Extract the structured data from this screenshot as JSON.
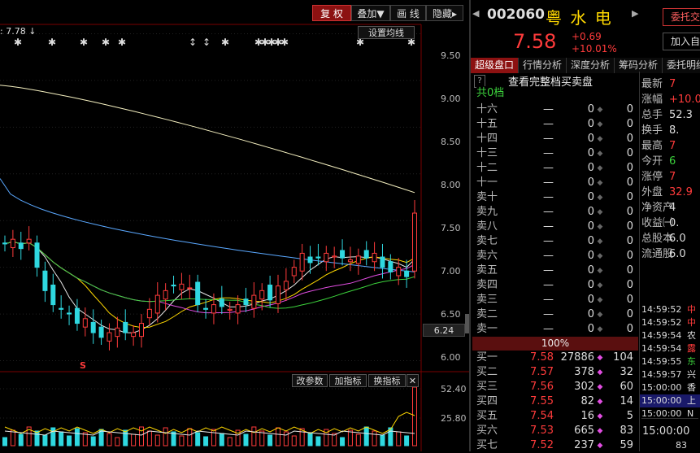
{
  "toolbar": {
    "fuquan": "复 权",
    "diejia": "叠加▼",
    "huaxian": "画 线",
    "yincang": "隐藏▸"
  },
  "chart": {
    "price_marker": ": 7.78 ↓",
    "ma_settings": "设置均线",
    "current_price_tag": "6.24",
    "s_marker": "S",
    "price_axis": [
      "9.50",
      "9.00",
      "8.50",
      "8.00",
      "7.50",
      "7.00",
      "6.50",
      "6.00"
    ],
    "volume_axis": [
      "52.40",
      "25.80"
    ],
    "vol_buttons": {
      "gaicanshu": "改参数",
      "jiazhibiao": "加指标",
      "huanzhibiao": "换指标",
      "close": "✕"
    }
  },
  "chart_data": {
    "type": "candlestick",
    "ylim": [
      5.9,
      9.6
    ],
    "closes": [
      7.25,
      7.3,
      7.2,
      7.3,
      7.0,
      6.75,
      6.6,
      6.55,
      6.5,
      6.4,
      6.45,
      6.3,
      6.25,
      6.3,
      6.35,
      6.3,
      6.3,
      6.4,
      6.55,
      6.7,
      6.75,
      6.8,
      6.82,
      6.78,
      6.6,
      6.55,
      6.6,
      6.58,
      6.55,
      6.6,
      6.6,
      6.7,
      6.75,
      6.65,
      6.8,
      6.85,
      7.0,
      7.15,
      7.05,
      7.1,
      7.15,
      7.12,
      7.1,
      7.08,
      7.12,
      7.1,
      7.15,
      7.0,
      6.95,
      7.0,
      6.9,
      7.58
    ],
    "ma_long_start": 8.95,
    "ma_long_end": 7.8
  },
  "stock": {
    "code": "002060",
    "name": "粤 水 电",
    "price": "7.58",
    "change": "+0.69",
    "change_pct": "+10.01%",
    "btn_weituo": "委托交",
    "btn_add": "加入自",
    "collapse_arrow": "◀",
    "expand_arrow": "▶"
  },
  "tabs": [
    "超级盘口",
    "行情分析",
    "深度分析",
    "筹码分析",
    "委托明细"
  ],
  "orderbook": {
    "help": "?",
    "view_full": "查看完整档买卖盘",
    "total_label": "共0档",
    "sell_rows": [
      {
        "label": "十六",
        "price": "—",
        "vol": "0",
        "cnt": "0"
      },
      {
        "label": "十五",
        "price": "—",
        "vol": "0",
        "cnt": "0"
      },
      {
        "label": "十四",
        "price": "—",
        "vol": "0",
        "cnt": "0"
      },
      {
        "label": "十三",
        "price": "—",
        "vol": "0",
        "cnt": "0"
      },
      {
        "label": "十二",
        "price": "—",
        "vol": "0",
        "cnt": "0"
      },
      {
        "label": "十一",
        "price": "—",
        "vol": "0",
        "cnt": "0"
      },
      {
        "label": "卖十",
        "price": "—",
        "vol": "0",
        "cnt": "0"
      },
      {
        "label": "卖九",
        "price": "—",
        "vol": "0",
        "cnt": "0"
      },
      {
        "label": "卖八",
        "price": "—",
        "vol": "0",
        "cnt": "0"
      },
      {
        "label": "卖七",
        "price": "—",
        "vol": "0",
        "cnt": "0"
      },
      {
        "label": "卖六",
        "price": "—",
        "vol": "0",
        "cnt": "0"
      },
      {
        "label": "卖五",
        "price": "—",
        "vol": "0",
        "cnt": "0"
      },
      {
        "label": "卖四",
        "price": "—",
        "vol": "0",
        "cnt": "0"
      },
      {
        "label": "卖三",
        "price": "—",
        "vol": "0",
        "cnt": "0"
      },
      {
        "label": "卖二",
        "price": "—",
        "vol": "0",
        "cnt": "0"
      },
      {
        "label": "卖一",
        "price": "—",
        "vol": "0",
        "cnt": "0"
      }
    ],
    "ratio": "100%",
    "buy_rows": [
      {
        "label": "买一",
        "price": "7.58",
        "vol": "27886",
        "cnt": "104"
      },
      {
        "label": "买二",
        "price": "7.57",
        "vol": "378",
        "cnt": "32"
      },
      {
        "label": "买三",
        "price": "7.56",
        "vol": "302",
        "cnt": "60"
      },
      {
        "label": "买四",
        "price": "7.55",
        "vol": "82",
        "cnt": "14"
      },
      {
        "label": "买五",
        "price": "7.54",
        "vol": "16",
        "cnt": "5"
      },
      {
        "label": "买六",
        "price": "7.53",
        "vol": "665",
        "cnt": "83"
      },
      {
        "label": "买七",
        "price": "7.52",
        "vol": "237",
        "cnt": "59"
      }
    ]
  },
  "stats": [
    {
      "label": "最新",
      "value": "7",
      "color": "red"
    },
    {
      "label": "涨幅",
      "value": "+10.0",
      "color": "red"
    },
    {
      "label": "总手",
      "value": "52.3",
      "color": "white"
    },
    {
      "label": "换手",
      "value": "8.",
      "color": "white"
    },
    {
      "label": "最高",
      "value": "7",
      "color": "red"
    },
    {
      "label": "今开",
      "value": "6",
      "color": "green"
    },
    {
      "label": "涨停",
      "value": "7",
      "color": "red"
    },
    {
      "label": "外盘",
      "value": "32.9",
      "color": "red"
    },
    {
      "label": "净资产",
      "value": "4",
      "color": "white"
    },
    {
      "label": "收益㈠",
      "value": "0.",
      "color": "white"
    },
    {
      "label": "总股本",
      "value": "6.0",
      "color": "white"
    },
    {
      "label": "流通股",
      "value": "6.0",
      "color": "white"
    }
  ],
  "ticks": [
    {
      "time": "14:59:52",
      "text": "中",
      "color": "red"
    },
    {
      "time": "14:59:52",
      "text": "中",
      "color": "red"
    },
    {
      "time": "14:59:54",
      "text": "农",
      "color": "white"
    },
    {
      "time": "14:59:54",
      "text": "露",
      "color": "red"
    },
    {
      "time": "14:59:55",
      "text": "东",
      "color": "green"
    },
    {
      "time": "14:59:57",
      "text": "兴",
      "color": "white"
    },
    {
      "time": "15:00:00",
      "text": "香",
      "color": "white"
    },
    {
      "time": "15:00:00",
      "text": "上",
      "color": "white"
    },
    {
      "time": "15:00:00",
      "text": "N",
      "color": "white"
    }
  ],
  "bottom": {
    "time": "15:00:00",
    "vol": "83"
  }
}
